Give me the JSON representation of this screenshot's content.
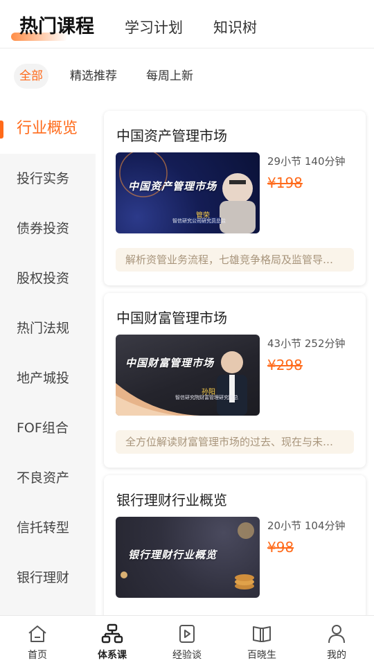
{
  "header": {
    "tabs": [
      {
        "label": "热门课程",
        "active": true
      },
      {
        "label": "学习计划",
        "active": false
      },
      {
        "label": "知识树",
        "active": false
      }
    ]
  },
  "filters": [
    {
      "label": "全部",
      "active": true
    },
    {
      "label": "精选推荐",
      "active": false
    },
    {
      "label": "每周上新",
      "active": false
    }
  ],
  "sidebar": {
    "items": [
      {
        "label": "行业概览",
        "active": true
      },
      {
        "label": "投行实务"
      },
      {
        "label": "债券投资"
      },
      {
        "label": "股权投资"
      },
      {
        "label": "热门法规"
      },
      {
        "label": "地产城投"
      },
      {
        "label": "FOF组合"
      },
      {
        "label": "不良资产"
      },
      {
        "label": "信托转型"
      },
      {
        "label": "银行理财"
      }
    ]
  },
  "courses": [
    {
      "title": "中国资产管理市场",
      "thumb_title": "中国资产管理市场",
      "lecturer": "管荣",
      "lecturer_role": "智信研究公司研究员总监",
      "meta": "29小节 140分钟",
      "price": "¥198",
      "desc": "解析资管业务流程，七雄竞争格局及监管导…"
    },
    {
      "title": "中国财富管理市场",
      "thumb_title": "中国财富管理市场",
      "lecturer": "孙阳",
      "lecturer_role": "智信研究院财富管理研究院总",
      "meta": "43小节 252分钟",
      "price": "¥298",
      "desc": "全方位解读财富管理市场的过去、现在与未…"
    },
    {
      "title": "银行理财行业概览",
      "thumb_title": "银行理财行业概览",
      "meta": "20小节 104分钟",
      "price": "¥98"
    }
  ],
  "bottom_nav": [
    {
      "label": "首页",
      "icon": "home-icon"
    },
    {
      "label": "体系课",
      "icon": "hierarchy-icon",
      "active": true
    },
    {
      "label": "经验谈",
      "icon": "video-icon"
    },
    {
      "label": "百晓生",
      "icon": "book-icon"
    },
    {
      "label": "我的",
      "icon": "user-icon"
    }
  ],
  "colors": {
    "accent": "#ff6a1a",
    "desc_bg": "#faf4ea",
    "sidebar_bg": "#f6f6f6"
  }
}
